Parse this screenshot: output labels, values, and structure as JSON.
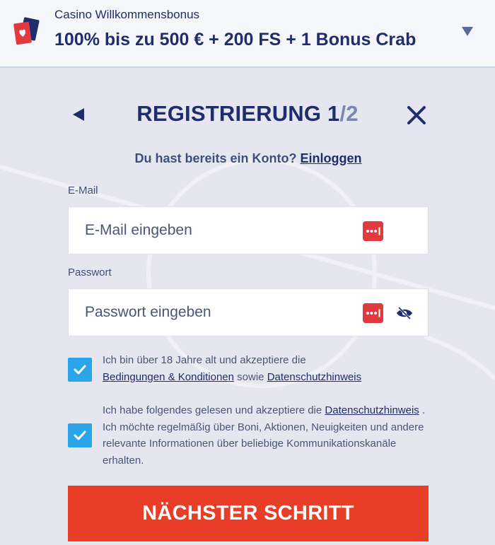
{
  "banner": {
    "subtitle": "Casino Willkommensbonus",
    "title": "100% bis zu 500 € + 200 FS + 1 Bonus Crab"
  },
  "header": {
    "title_main": "REGISTRIERUNG 1",
    "title_step": "/2"
  },
  "login": {
    "prompt": "Du hast bereits ein Konto?",
    "link": "Einloggen"
  },
  "form": {
    "email_label": "E-Mail",
    "email_placeholder": "E-Mail eingeben",
    "password_label": "Passwort",
    "password_placeholder": "Passwort eingeben"
  },
  "consents": [
    {
      "checked": true,
      "text1": "Ich bin über 18 Jahre alt und akzeptiere die",
      "link1": "Bedingungen & Konditionen",
      "text2": "sowie",
      "link2": "Datenschutzhinweis"
    },
    {
      "checked": true,
      "text1": "Ich habe folgendes gelesen und akzeptiere die",
      "link1": "Datenschutzhinweis",
      "text2": ". Ich möchte regelmäßig über Boni, Aktionen, Neuigkeiten und andere relevante Informationen über beliebige Kommunikationskanäle erhalten."
    }
  ],
  "submit_label": "NÄCHSTER SCHRITT",
  "colors": {
    "primary": "#1f2d6b",
    "accent_red": "#e83d27",
    "checkbox_blue": "#2aa5ea",
    "background": "#e6e6f0"
  },
  "icons": {
    "banner": "playing-cards-icon",
    "banner_toggle": "chevron-down-icon",
    "back": "back-arrow-icon",
    "close": "close-icon",
    "password_manager": "password-manager-icon",
    "visibility": "eye-slash-icon",
    "check": "checkmark-icon"
  }
}
